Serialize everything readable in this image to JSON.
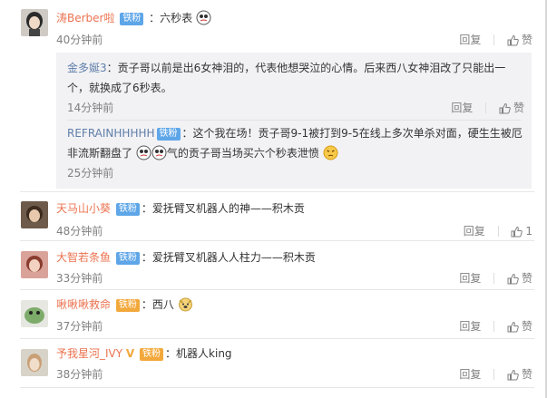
{
  "actions": {
    "reply": "回复",
    "like": "赞"
  },
  "comments": [
    {
      "user": "涛Berber啦",
      "badge": "铁粉",
      "text": "：六秒表",
      "time": "40分钟前",
      "likes": ""
    },
    {
      "user": "天马山小葵",
      "badge": "铁粉",
      "text": "：爱抚臂叉机器人的神——积木贡",
      "time": "48分钟前",
      "likes": "1"
    },
    {
      "user": "大智若条鱼",
      "badge": "铁粉",
      "text": "：爱抚臂叉机器人人柱力——积木贡",
      "time": "33分钟前",
      "likes": ""
    },
    {
      "user": "啾啾啾救命",
      "badge": "铁粉",
      "text": "：西八",
      "time": "37分钟前",
      "likes": ""
    },
    {
      "user": "予我星河_IVY",
      "badge": "铁粉",
      "text": "：机器人king",
      "time": "38分钟前",
      "likes": ""
    }
  ],
  "replies": [
    {
      "user": "金多娫3",
      "text_line1": "：贡子哥以前是出6女神泪的，代表他想哭泣的心情。后来西八女神泪改了只能出一",
      "text_line2": "个，就换成了6秒表。",
      "time": "14分钟前"
    },
    {
      "user": "REFRAINHHHHH",
      "badge": "铁粉",
      "text_line1": "：这个我在场！贡子哥9-1被打到9-5在线上多次单杀对面，硬生生被厄",
      "text_line2_a": "非流斯翻盘了",
      "text_line2_b": "气的贡子哥当场买六个秒表泄愤",
      "time": "25分钟前"
    }
  ],
  "colors": {
    "username": "#eb7350",
    "reply_user": "#5f7ea8",
    "badge_blue": "#5ea6e8",
    "badge_gold": "#f3a83b",
    "muted": "#808080",
    "reply_bg": "#f2f2f5"
  }
}
